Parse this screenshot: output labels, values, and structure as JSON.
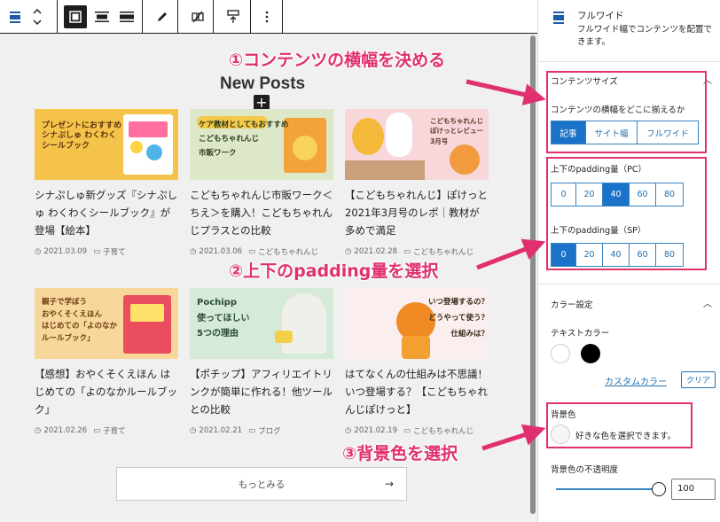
{
  "annotations": {
    "step1": "①コンテンツの横幅を決める",
    "step2": "②上下のpadding量を選択",
    "step3": "③背景色を選択"
  },
  "main": {
    "section_title": "New Posts",
    "more_button": "もっとみる",
    "more_arrow": "→",
    "posts": [
      {
        "thumb_text": "プレゼントにおすすめ\nシナぷしゅ わくわく\nシールブック",
        "title": "シナぷしゅ新グッズ『シナぷしゅ わくわくシールブック』が登場【絵本】",
        "date": "2021.03.09",
        "category": "子育て"
      },
      {
        "thumb_text": "ケア教材としてもおすすめ\nこどもちゃれんじ\n市販ワーク",
        "title": "こどもちゃれんじ市販ワーク＜ちえ＞を購入！こどもちゃれんじプラスとの比較",
        "date": "2021.03.06",
        "category": "こどもちゃれんじ"
      },
      {
        "thumb_text": "こどもちゃれんじ\nぽけっとレビュー\n3月号",
        "title": "【こどもちゃれんじ】ぽけっと2021年3月号のレポ｜教材が多めで満足",
        "date": "2021.02.28",
        "category": "こどもちゃれんじ"
      },
      {
        "thumb_text": "親子で学ぼう\nおやくそくえほん\nはじめての「よのなかルールブック」",
        "title": "【感想】おやくそくえほん はじめての「よのなかルールブック」",
        "date": "2021.02.26",
        "category": "子育て"
      },
      {
        "thumb_text": "Pochipp\n使ってほしい\n5つの理由",
        "title": "【ポチップ】アフィリエイトリンクが簡単に作れる！他ツールとの比較",
        "date": "2021.02.21",
        "category": "ブログ"
      },
      {
        "thumb_text": "いつ登場するの？\nどうやって使う？\n仕組みは？",
        "title": "はてなくんの仕組みは不思議！いつ登場する？【こどもちゃれんじぽけっと】",
        "date": "2021.02.19",
        "category": "こどもちゃれんじ"
      }
    ]
  },
  "sidebar": {
    "block_title": "フルワイド",
    "block_desc": "フルワイド幅でコンテンツを配置できます。",
    "content_size": {
      "panel_title": "コンテンツサイズ",
      "width_label": "コンテンツの横幅をどこに揃えるか",
      "width_options": [
        "記事",
        "サイト幅",
        "フルワイド"
      ],
      "width_selected": "記事"
    },
    "padding_pc": {
      "label": "上下のpadding量（PC）",
      "options": [
        "0",
        "20",
        "40",
        "60",
        "80"
      ],
      "selected": "40"
    },
    "padding_sp": {
      "label": "上下のpadding量（SP）",
      "options": [
        "0",
        "20",
        "40",
        "60",
        "80"
      ],
      "selected": "0"
    },
    "color": {
      "panel_title": "カラー設定",
      "text_color_label": "テキストカラー",
      "custom_color_link": "カスタムカラー",
      "clear_button": "クリア",
      "swatches": [
        "#ffffff",
        "#000000"
      ],
      "bg_label": "背景色",
      "bg_hint": "好きな色を選択できます。",
      "opacity_label": "背景色の不透明度",
      "opacity_value": "100"
    }
  },
  "colors": {
    "accent": "#1a73c9",
    "annotation": "#e0306f"
  }
}
